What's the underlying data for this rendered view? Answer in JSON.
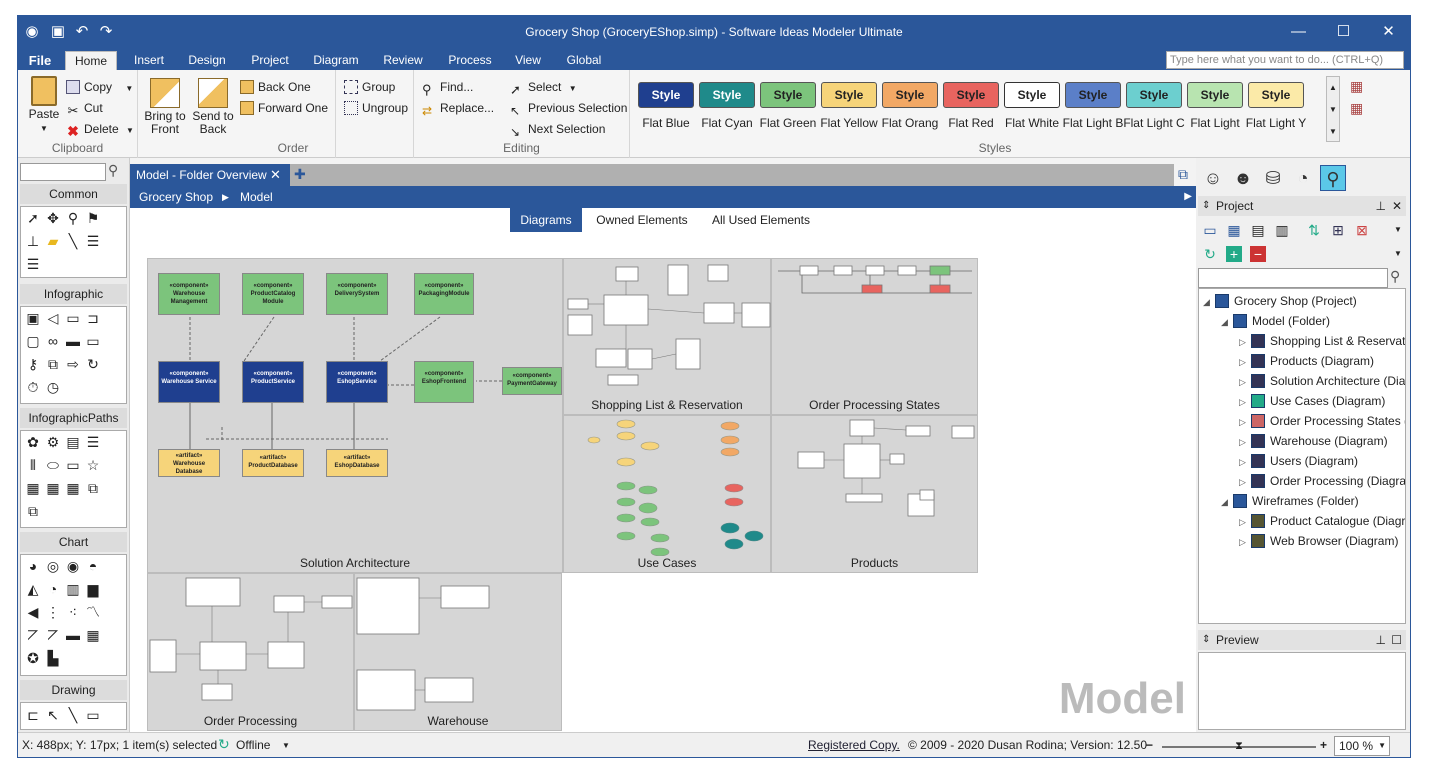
{
  "window": {
    "title": "Grocery Shop (GroceryEShop.simp) - Software Ideas Modeler Ultimate",
    "minimize": "—",
    "maximize": "☐",
    "close": "✕"
  },
  "ribbon_tabs": [
    {
      "label": "File"
    },
    {
      "label": "Home"
    },
    {
      "label": "Insert"
    },
    {
      "label": "Design"
    },
    {
      "label": "Project"
    },
    {
      "label": "Diagram"
    },
    {
      "label": "Review"
    },
    {
      "label": "Process"
    },
    {
      "label": "View"
    },
    {
      "label": "Global"
    }
  ],
  "search": {
    "placeholder": "Type here what you want to do... (CTRL+Q)"
  },
  "clipboard": {
    "paste": "Paste",
    "copy": "Copy",
    "cut": "Cut",
    "delete": "Delete",
    "group": "Clipboard"
  },
  "order": {
    "bring_front_1": "Bring to",
    "bring_front_2": "Front",
    "send_back_1": "Send to",
    "send_back_2": "Back",
    "back_one": "Back One",
    "forward_one": "Forward One",
    "group_btn": "Group",
    "ungroup": "Ungroup",
    "group": "Order"
  },
  "editing": {
    "find": "Find...",
    "replace": "Replace...",
    "select": "Select",
    "prev_sel": "Previous Selection",
    "next_sel": "Next Selection",
    "group": "Editing"
  },
  "styles": {
    "group": "Styles",
    "card_text": "Style",
    "items": [
      {
        "name": "Flat Blue",
        "bg": "#1f3f8f",
        "fg": "#ffffff"
      },
      {
        "name": "Flat Cyan",
        "bg": "#1f8a8a",
        "fg": "#ffffff"
      },
      {
        "name": "Flat Green",
        "bg": "#7cc47c",
        "fg": "#222222"
      },
      {
        "name": "Flat Yellow",
        "bg": "#f6d47a",
        "fg": "#222222"
      },
      {
        "name": "Flat Orang",
        "bg": "#f2a865",
        "fg": "#222222"
      },
      {
        "name": "Flat Red",
        "bg": "#e8645f",
        "fg": "#222222"
      },
      {
        "name": "Flat White",
        "bg": "#ffffff",
        "fg": "#222222"
      },
      {
        "name": "Flat Light B",
        "bg": "#5b7fc8",
        "fg": "#222222"
      },
      {
        "name": "Flat Light C",
        "bg": "#6ccfcf",
        "fg": "#222222"
      },
      {
        "name": "Flat Light",
        "bg": "#b8e4b0",
        "fg": "#222222"
      },
      {
        "name": "Flat Light Y",
        "bg": "#fbeaa8",
        "fg": "#222222"
      }
    ]
  },
  "toolbox": {
    "sections": [
      "Common",
      "Infographic",
      "InfographicPaths",
      "Chart",
      "Drawing"
    ]
  },
  "document": {
    "tab_label": "Model - Folder Overview",
    "tab_close": "✕",
    "add_tab": "✚",
    "breadcrumb": [
      "Grocery Shop",
      "Model"
    ],
    "view_tabs": [
      "Diagrams",
      "Owned Elements",
      "All Used Elements"
    ],
    "watermark": "Model",
    "thumbnails": [
      {
        "label": "Solution Architecture"
      },
      {
        "label": "Shopping List & Reservation"
      },
      {
        "label": "Order Processing States"
      },
      {
        "label": "Use Cases"
      },
      {
        "label": "Products"
      },
      {
        "label": "Order Processing"
      },
      {
        "label": "Warehouse"
      }
    ],
    "components": [
      {
        "stereo": "«component»",
        "name": "Warehouse Management"
      },
      {
        "stereo": "«component»",
        "name": "ProductCatalog Module"
      },
      {
        "stereo": "«component»",
        "name": "DeliverySystem"
      },
      {
        "stereo": "«component»",
        "name": "PackagingModule"
      },
      {
        "stereo": "«component»",
        "name": "Warehouse Service"
      },
      {
        "stereo": "«component»",
        "name": "ProductService"
      },
      {
        "stereo": "«component»",
        "name": "EshopService"
      },
      {
        "stereo": "«component»",
        "name": "EshopFrontend"
      },
      {
        "stereo": "«component»",
        "name": "PaymentGateway"
      },
      {
        "stereo": "«artifact»",
        "name": "Warehouse Database"
      },
      {
        "stereo": "«artifact»",
        "name": "ProductDatabase"
      },
      {
        "stereo": "«artifact»",
        "name": "EshopDatabase"
      }
    ]
  },
  "project_panel": {
    "title": "Project",
    "tree": [
      {
        "label": "Grocery Shop (Project)"
      },
      {
        "label": "Model (Folder)"
      },
      {
        "label": "Shopping List & Reservatio"
      },
      {
        "label": "Products (Diagram)"
      },
      {
        "label": "Solution Architecture (Diag"
      },
      {
        "label": "Use Cases (Diagram)"
      },
      {
        "label": "Order Processing States (I"
      },
      {
        "label": "Warehouse (Diagram)"
      },
      {
        "label": "Users (Diagram)"
      },
      {
        "label": "Order Processing (Diagram"
      },
      {
        "label": "Wireframes (Folder)"
      },
      {
        "label": "Product Catalogue (Diagra"
      },
      {
        "label": "Web Browser (Diagram)"
      }
    ],
    "preview_title": "Preview"
  },
  "status": {
    "position": "X: 488px; Y: 17px; 1 item(s) selected",
    "online": "Offline",
    "registered": "Registered Copy.",
    "copyright": "© 2009 - 2020 Dusan Rodina; Version: 12.50",
    "zoom": "100 %",
    "zoom_level": 0.5
  }
}
